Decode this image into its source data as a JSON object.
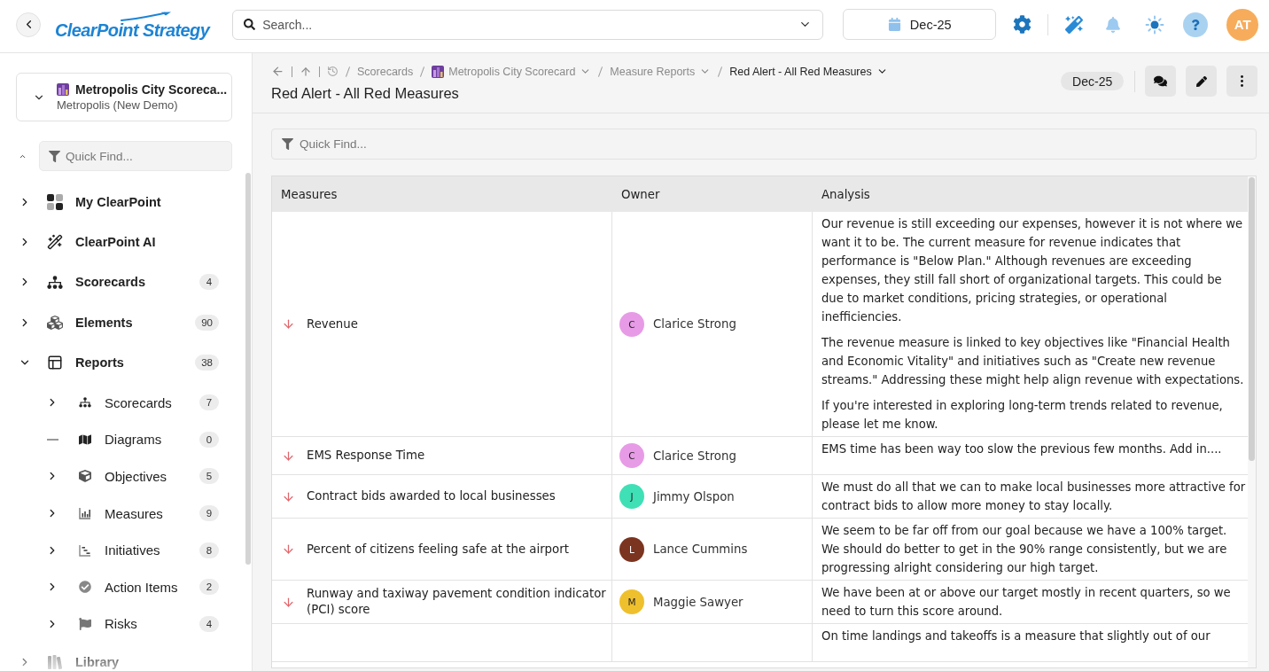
{
  "topbar": {
    "logo": "ClearPoint Strategy",
    "search": {
      "placeholder": "Search..."
    },
    "period": "Dec-25",
    "user_initials": "AT"
  },
  "sidebar": {
    "scorecard": {
      "name": "Metropolis City Scoreca...",
      "subtitle": "Metropolis (New Demo)"
    },
    "quick_find": {
      "placeholder": "Quick Find..."
    },
    "nav": [
      {
        "label": "My ClearPoint",
        "expanded": false
      },
      {
        "label": "ClearPoint AI",
        "expanded": false
      },
      {
        "label": "Scorecards",
        "count": "4",
        "expanded": false
      },
      {
        "label": "Elements",
        "count": "90",
        "expanded": false
      },
      {
        "label": "Reports",
        "count": "38",
        "expanded": true,
        "children": [
          {
            "label": "Scorecards",
            "count": "7",
            "expandable": true,
            "expanded": false
          },
          {
            "label": "Diagrams",
            "count": "0",
            "expandable": false
          },
          {
            "label": "Objectives",
            "count": "5",
            "expandable": true,
            "expanded": false
          },
          {
            "label": "Measures",
            "count": "9",
            "expandable": true,
            "expanded": false
          },
          {
            "label": "Initiatives",
            "count": "8",
            "expandable": true,
            "expanded": false
          },
          {
            "label": "Action Items",
            "count": "2",
            "expandable": true,
            "expanded": false
          },
          {
            "label": "Risks",
            "count": "4",
            "expandable": true,
            "expanded": false
          }
        ]
      },
      {
        "label": "Library",
        "expanded": false
      }
    ]
  },
  "page": {
    "breadcrumb": [
      {
        "label": "Scorecards",
        "kind": "link",
        "dropdown": false,
        "current": false
      },
      {
        "label": "Metropolis City Scorecard",
        "kind": "scorecard",
        "dropdown": true,
        "current": false
      },
      {
        "label": "Measure Reports",
        "kind": "link",
        "dropdown": true,
        "current": false
      },
      {
        "label": "Red Alert - All Red Measures",
        "kind": "link",
        "dropdown": true,
        "current": true
      }
    ],
    "title": "Red Alert - All Red Measures",
    "period": "Dec-25"
  },
  "filter": {
    "placeholder": "Quick Find..."
  },
  "table": {
    "columns": [
      "Measures",
      "Owner",
      "Analysis"
    ],
    "rows": [
      {
        "measure": "Revenue",
        "owner": {
          "initial": "C",
          "name": "Clarice Strong",
          "color": "#e79be6"
        },
        "analysis": [
          "Our revenue is still exceeding our expenses, however it is not where we want it to be. The current measure for revenue indicates that performance is \"Below Plan.\" Although revenues are exceeding expenses, they still fall short of organizational targets. This could be due to market conditions, pricing strategies, or operational inefficiencies.",
          "The revenue measure is linked to key objectives like \"Financial Health and Economic Vitality\" and initiatives such as \"Create new revenue streams.\" Addressing these might help align revenue with expectations.",
          "If you're interested in exploring long-term trends related to revenue, please let me know."
        ]
      },
      {
        "measure": "EMS Response Time",
        "owner": {
          "initial": "C",
          "name": "Clarice Strong",
          "color": "#e79be6"
        },
        "analysis": [
          "EMS time has been way too slow the previous few months. Add in...."
        ]
      },
      {
        "measure": "Contract bids awarded to local businesses",
        "owner": {
          "initial": "J",
          "name": "Jimmy Olspon",
          "color": "#3fe0b5"
        },
        "analysis": [
          "We must do all that we can to make local businesses more attractive for contract bids to allow more money to stay locally."
        ]
      },
      {
        "measure": "Percent of citizens feeling safe at the airport",
        "owner": {
          "initial": "L",
          "name": "Lance Cummins",
          "color": "#7b3420"
        },
        "analysis": [
          "We seem to be far off from our goal because we have a 100% target. We should do better to get in the 90% range consistently, but we are progressing alright considering our high target."
        ]
      },
      {
        "measure": "Runway and taxiway pavement condition indicator (PCI) score",
        "owner": {
          "initial": "M",
          "name": "Maggie Sawyer",
          "color": "#efc02d"
        },
        "analysis": [
          "We have been at or above our target mostly in recent quarters, so we need to turn this score around."
        ]
      },
      {
        "analysis": [
          "On time landings and takeoffs is a measure that slightly out of our"
        ]
      }
    ]
  }
}
